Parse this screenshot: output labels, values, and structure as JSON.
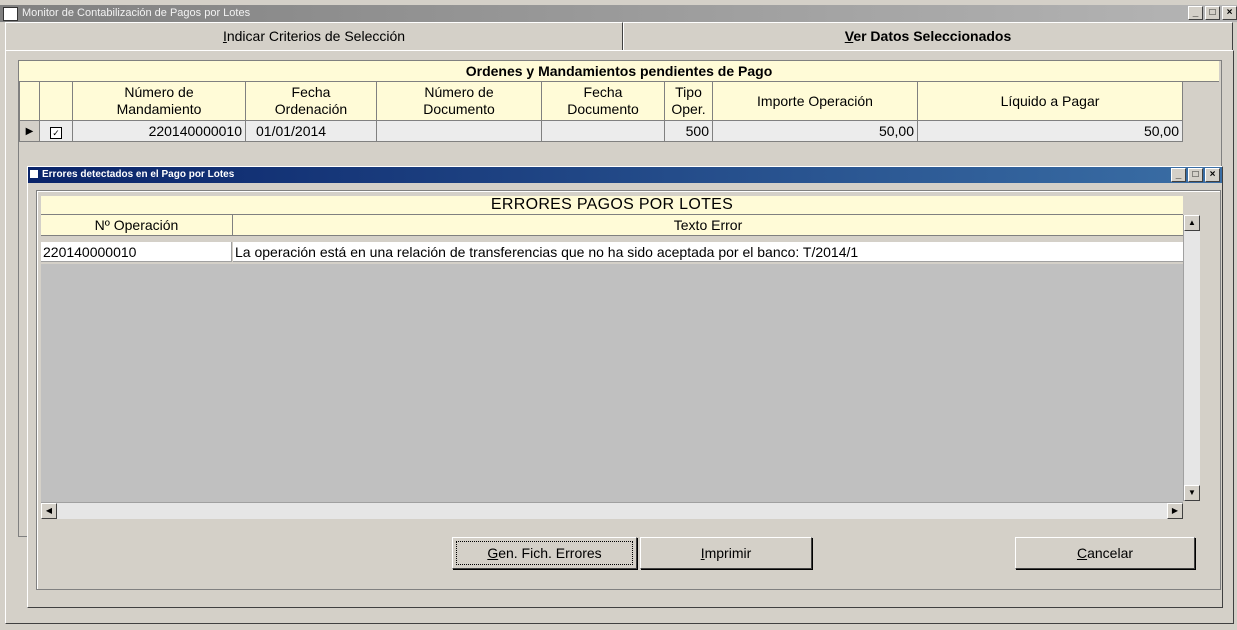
{
  "window": {
    "title": "Monitor de Contabilización de Pagos por Lotes",
    "controls": [
      "_",
      "□",
      "×"
    ]
  },
  "tabs": [
    {
      "label": "Indicar Criterios de Selección",
      "mnemonic": "I",
      "rest": "ndicar Criterios de Selección",
      "active": false
    },
    {
      "label": "Ver Datos Seleccionados",
      "mnemonic": "V",
      "rest": "er Datos Seleccionados",
      "active": true
    }
  ],
  "main_grid": {
    "caption": "Ordenes y Mandamientos pendientes de Pago",
    "columns": [
      {
        "l1": "Número de",
        "l2": "Mandamiento"
      },
      {
        "l1": "Fecha",
        "l2": "Ordenación"
      },
      {
        "l1": "Número de",
        "l2": "Documento"
      },
      {
        "l1": "Fecha",
        "l2": "Documento"
      },
      {
        "l1": "Tipo",
        "l2": "Oper."
      },
      {
        "l1": "Importe Operación",
        "l2": ""
      },
      {
        "l1": "Líquido a Pagar",
        "l2": ""
      }
    ],
    "rows": [
      {
        "indicator": "▶",
        "checked": true,
        "numero_mandamiento": "220140000010",
        "fecha_ordenacion": "01/01/2014",
        "numero_documento": "",
        "fecha_documento": "",
        "tipo_oper": "500",
        "importe_operacion": "50,00",
        "liquido_pagar": "50,00"
      }
    ]
  },
  "dialog": {
    "title": "Errores detectados en el Pago por Lotes",
    "controls": [
      "_",
      "□",
      "×"
    ],
    "grid": {
      "caption": "ERRORES PAGOS POR LOTES",
      "columns": [
        "Nº Operación",
        "Texto Error"
      ],
      "rows": [
        {
          "operacion": "220140000010",
          "texto": "La operación está en una relación de transferencias que no ha sido aceptada por el banco: T/2014/1"
        }
      ]
    },
    "buttons": [
      {
        "mn": "G",
        "rest": "en. Fich. Errores",
        "label": "Gen. Fich. Errores"
      },
      {
        "mn": "I",
        "rest": "mprimir",
        "label": "Imprimir"
      },
      {
        "mn": "C",
        "rest": "ancelar",
        "label": "Cancelar"
      }
    ]
  }
}
